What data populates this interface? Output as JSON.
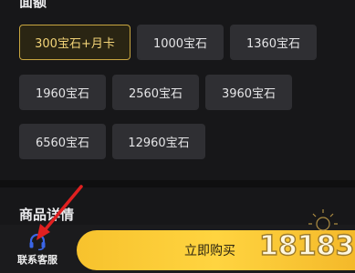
{
  "amount_section": {
    "label": "面额"
  },
  "options": [
    {
      "label": "300宝石+月卡",
      "selected": true
    },
    {
      "label": "1000宝石",
      "selected": false
    },
    {
      "label": "1360宝石",
      "selected": false
    },
    {
      "label": "1960宝石",
      "selected": false
    },
    {
      "label": "2560宝石",
      "selected": false
    },
    {
      "label": "3960宝石",
      "selected": false
    },
    {
      "label": "6560宝石",
      "selected": false
    },
    {
      "label": "12960宝石",
      "selected": false
    }
  ],
  "detail_section": {
    "label": "商品详情"
  },
  "bottom": {
    "service_label": "联系客服",
    "buy_label": "立即购买"
  },
  "watermark": {
    "text": "18183"
  },
  "colors": {
    "accent": "#f7c22d",
    "selected_border": "#c9a640",
    "arrow": "#e02020",
    "service_icon": "#3a66e8"
  }
}
